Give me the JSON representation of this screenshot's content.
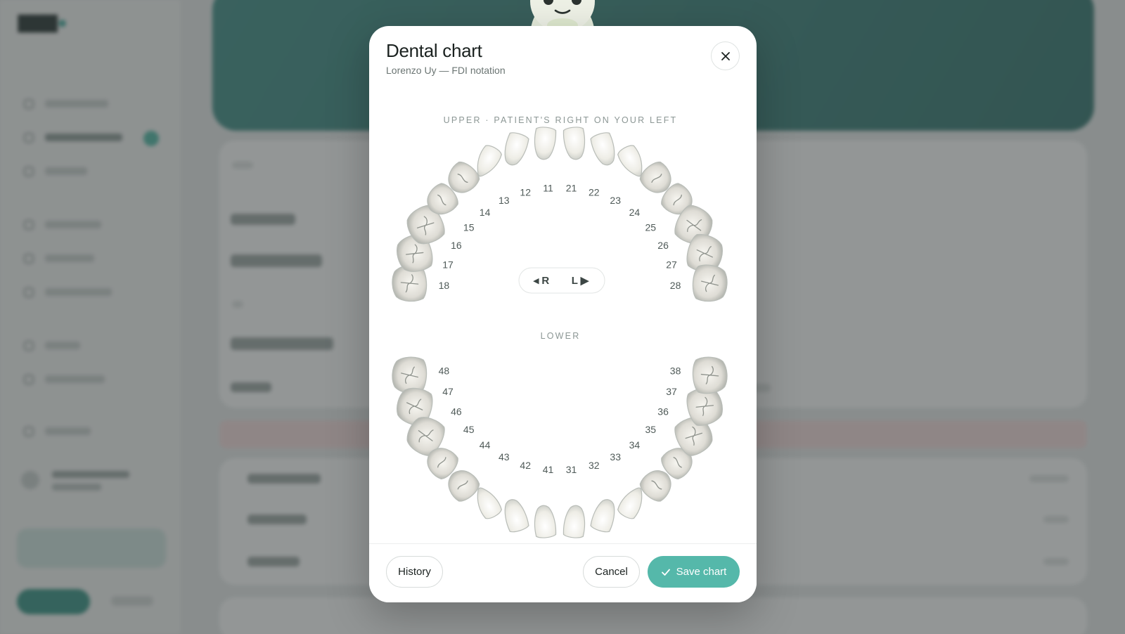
{
  "modal": {
    "title": "Dental chart",
    "subtitle": "Lorenzo Uy — FDI notation",
    "close_icon": "close-icon"
  },
  "chart": {
    "notation": "FDI",
    "upper_label": "UPPER · PATIENT'S RIGHT ON YOUR LEFT",
    "lower_label": "LOWER",
    "toggle": {
      "right_label": "◂ R",
      "left_label": "L ▶"
    },
    "upper_teeth": [
      {
        "number": "18",
        "type": "molar"
      },
      {
        "number": "17",
        "type": "molar"
      },
      {
        "number": "16",
        "type": "molar"
      },
      {
        "number": "15",
        "type": "premolar"
      },
      {
        "number": "14",
        "type": "premolar"
      },
      {
        "number": "13",
        "type": "canine"
      },
      {
        "number": "12",
        "type": "incisor"
      },
      {
        "number": "11",
        "type": "incisor"
      },
      {
        "number": "21",
        "type": "incisor"
      },
      {
        "number": "22",
        "type": "incisor"
      },
      {
        "number": "23",
        "type": "canine"
      },
      {
        "number": "24",
        "type": "premolar"
      },
      {
        "number": "25",
        "type": "premolar"
      },
      {
        "number": "26",
        "type": "molar"
      },
      {
        "number": "27",
        "type": "molar"
      },
      {
        "number": "28",
        "type": "molar"
      }
    ],
    "lower_teeth": [
      {
        "number": "48",
        "type": "molar"
      },
      {
        "number": "47",
        "type": "molar"
      },
      {
        "number": "46",
        "type": "molar"
      },
      {
        "number": "45",
        "type": "premolar"
      },
      {
        "number": "44",
        "type": "premolar"
      },
      {
        "number": "43",
        "type": "canine"
      },
      {
        "number": "42",
        "type": "incisor"
      },
      {
        "number": "41",
        "type": "incisor"
      },
      {
        "number": "31",
        "type": "incisor"
      },
      {
        "number": "32",
        "type": "incisor"
      },
      {
        "number": "33",
        "type": "canine"
      },
      {
        "number": "34",
        "type": "premolar"
      },
      {
        "number": "35",
        "type": "premolar"
      },
      {
        "number": "36",
        "type": "molar"
      },
      {
        "number": "37",
        "type": "molar"
      },
      {
        "number": "38",
        "type": "molar"
      }
    ]
  },
  "footer": {
    "history_label": "History",
    "cancel_label": "Cancel",
    "save_label": "Save chart",
    "save_icon": "check-icon"
  },
  "colors": {
    "accent": "#55b8aa",
    "tooth_fill": "#f1f0ea",
    "molar_fill": "#e9e8e2",
    "tooth_stroke": "#b9bdb8",
    "label_color": "#4f5a58"
  }
}
